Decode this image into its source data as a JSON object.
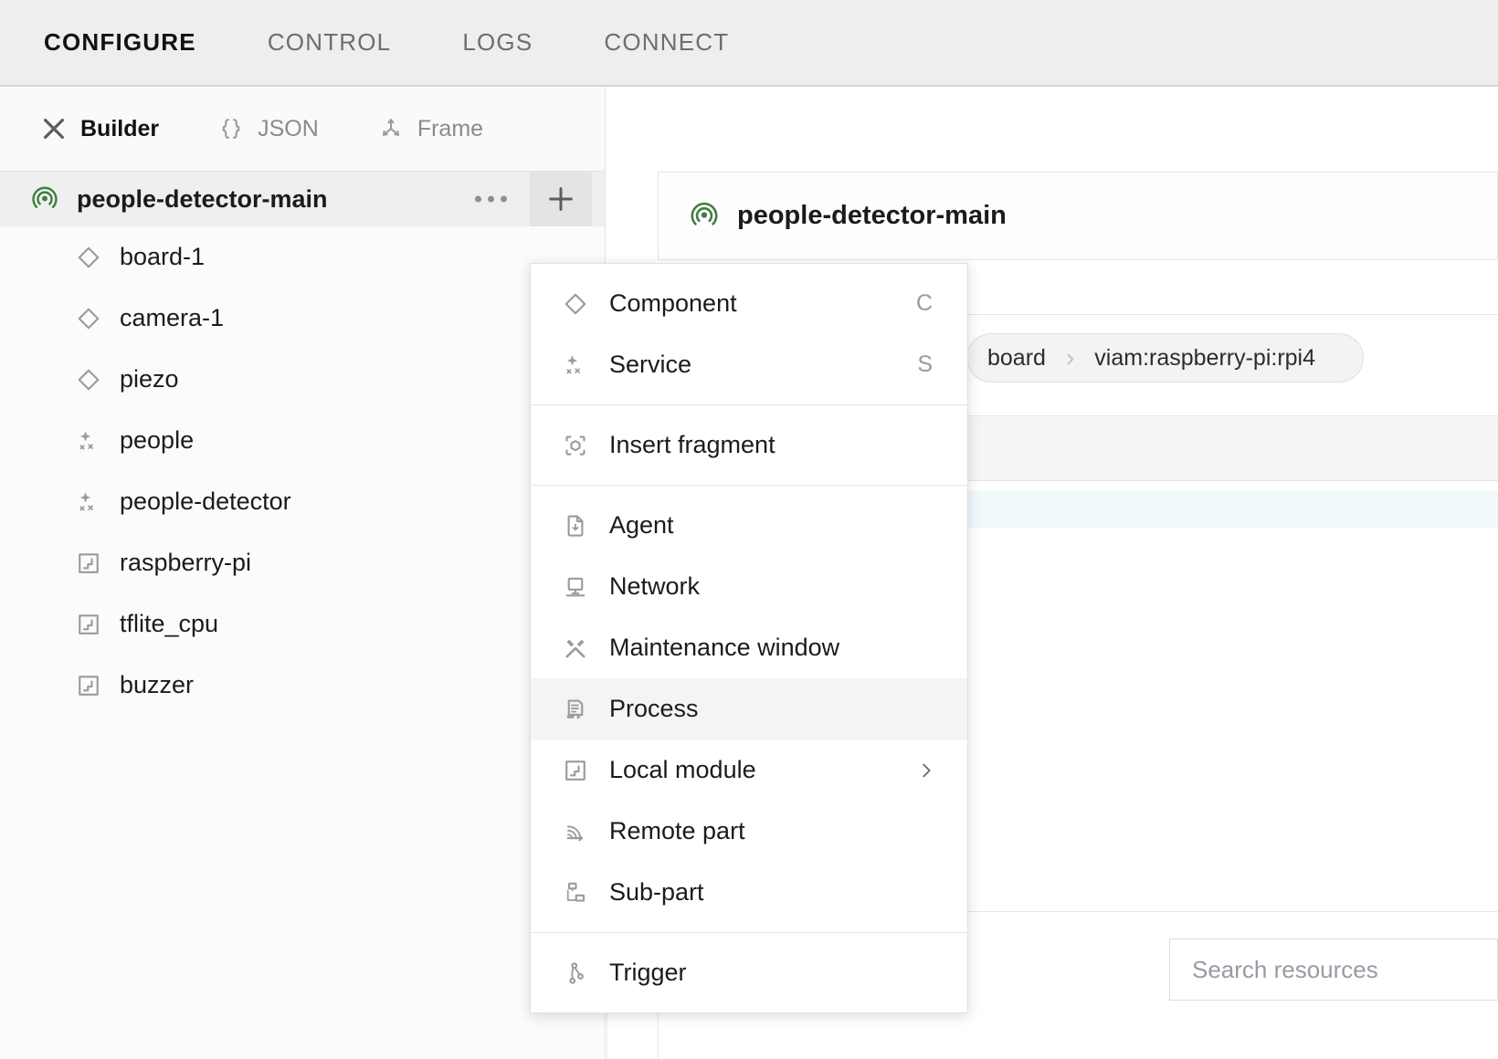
{
  "topnav": {
    "tabs": [
      {
        "label": "CONFIGURE",
        "active": true
      },
      {
        "label": "CONTROL",
        "active": false
      },
      {
        "label": "LOGS",
        "active": false
      },
      {
        "label": "CONNECT",
        "active": false
      }
    ]
  },
  "subnav": {
    "items": [
      {
        "label": "Builder",
        "icon": "tools-icon",
        "active": true
      },
      {
        "label": "JSON",
        "icon": "braces-icon",
        "active": false
      },
      {
        "label": "Frame",
        "icon": "frame-axes-icon",
        "active": false
      }
    ]
  },
  "sidebar": {
    "root": {
      "label": "people-detector-main",
      "icon": "radar-icon",
      "more_icon": "ellipsis-icon",
      "add_icon": "plus-icon"
    },
    "items": [
      {
        "label": "board-1",
        "icon": "diamond-icon",
        "kind": "component"
      },
      {
        "label": "camera-1",
        "icon": "diamond-icon",
        "kind": "component"
      },
      {
        "label": "piezo",
        "icon": "diamond-icon",
        "kind": "component"
      },
      {
        "label": "people",
        "icon": "sparkle-icon",
        "kind": "service"
      },
      {
        "label": "people-detector",
        "icon": "sparkle-icon",
        "kind": "service"
      },
      {
        "label": "raspberry-pi",
        "icon": "module-icon",
        "kind": "module"
      },
      {
        "label": "tflite_cpu",
        "icon": "module-icon",
        "kind": "module"
      },
      {
        "label": "buzzer",
        "icon": "module-icon",
        "kind": "module"
      }
    ]
  },
  "main": {
    "card_title": "people-detector-main",
    "card_icon": "radar-icon",
    "breadcrumb": {
      "segments": [
        "board",
        "viam:raspberry-pi:rpi4"
      ],
      "separator": "›"
    },
    "search": {
      "placeholder": "Search resources"
    }
  },
  "menu": {
    "groups": [
      {
        "items": [
          {
            "label": "Component",
            "icon": "diamond-icon",
            "shortcut": "C",
            "hover": false,
            "submenu": false
          },
          {
            "label": "Service",
            "icon": "sparkle-icon",
            "shortcut": "S",
            "hover": false,
            "submenu": false
          }
        ]
      },
      {
        "items": [
          {
            "label": "Insert fragment",
            "icon": "fragment-cube-icon",
            "shortcut": "",
            "hover": false,
            "submenu": false
          }
        ]
      },
      {
        "items": [
          {
            "label": "Agent",
            "icon": "file-download-icon",
            "shortcut": "",
            "hover": false,
            "submenu": false
          },
          {
            "label": "Network",
            "icon": "monitor-icon",
            "shortcut": "",
            "hover": false,
            "submenu": false
          },
          {
            "label": "Maintenance window",
            "icon": "hammer-wrench-icon",
            "shortcut": "",
            "hover": false,
            "submenu": false
          },
          {
            "label": "Process",
            "icon": "process-icon",
            "shortcut": "",
            "hover": true,
            "submenu": false
          },
          {
            "label": "Local module",
            "icon": "module-icon",
            "shortcut": "",
            "hover": false,
            "submenu": true
          },
          {
            "label": "Remote part",
            "icon": "remote-signal-icon",
            "shortcut": "",
            "hover": false,
            "submenu": false
          },
          {
            "label": "Sub-part",
            "icon": "subpart-icon",
            "shortcut": "",
            "hover": false,
            "submenu": false
          }
        ]
      },
      {
        "items": [
          {
            "label": "Trigger",
            "icon": "trigger-icon",
            "shortcut": "",
            "hover": false,
            "submenu": false
          }
        ]
      }
    ]
  },
  "colors": {
    "accent_green": "#3f7d3f",
    "icon_gray": "#9a9aa2",
    "text_dark": "#1b1b1b",
    "hover_bg": "#f4f4f4",
    "band_blue": "#f1f8fb"
  }
}
